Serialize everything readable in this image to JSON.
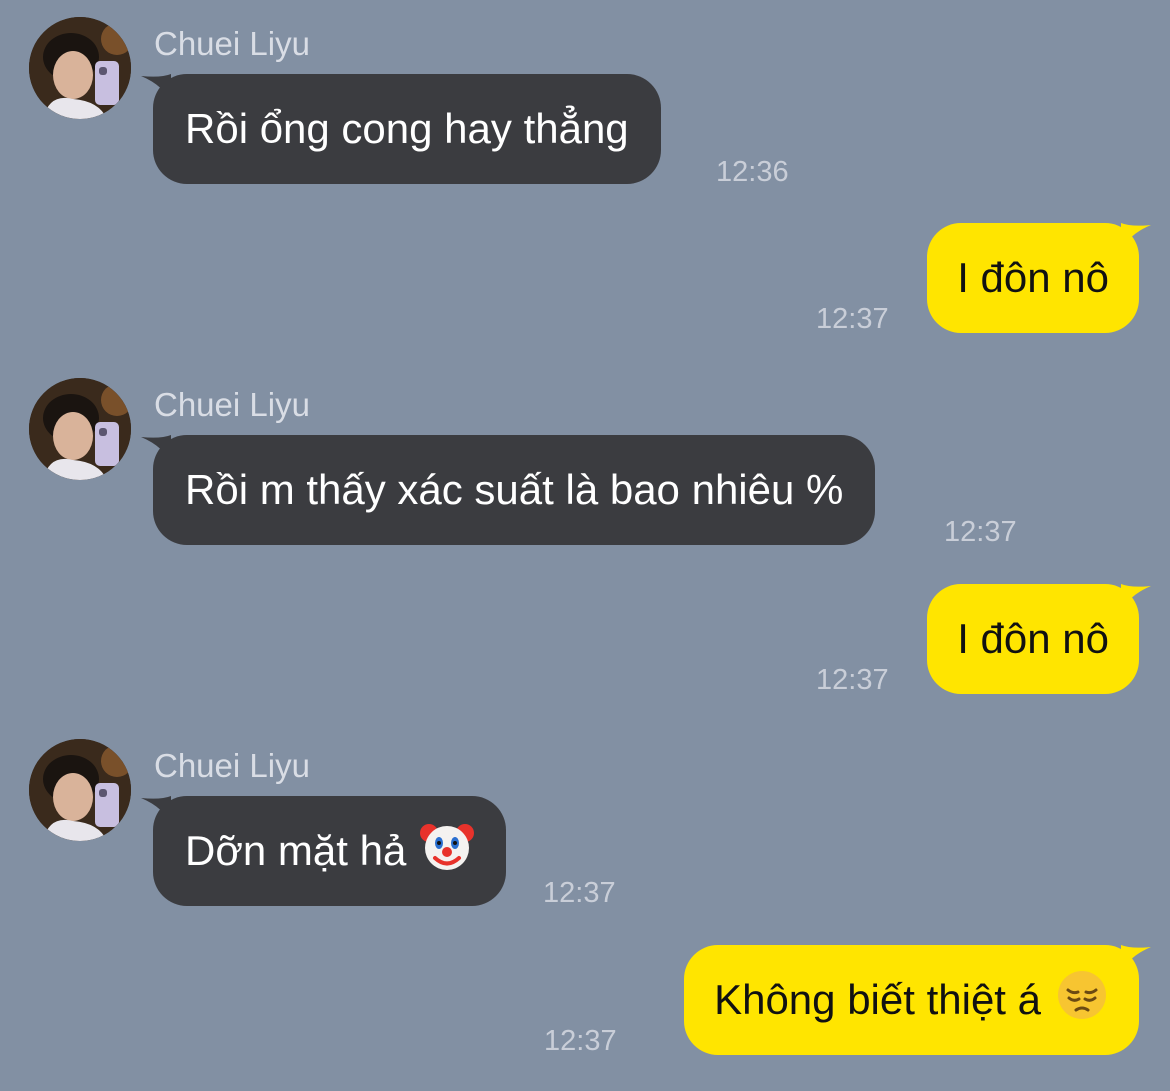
{
  "messages": [
    {
      "direction": "incoming",
      "sender": "Chuei Liyu",
      "text": "Rồi ổng cong hay thẳng",
      "time": "12:36"
    },
    {
      "direction": "outgoing",
      "text": "I đôn nô",
      "time": "12:37"
    },
    {
      "direction": "incoming",
      "sender": "Chuei Liyu",
      "text": "Rồi m thấy xác suất là bao nhiêu %",
      "time": "12:37"
    },
    {
      "direction": "outgoing",
      "text": "I đôn nô",
      "time": "12:37"
    },
    {
      "direction": "incoming",
      "sender": "Chuei Liyu",
      "text": "Dỡn mặt hả",
      "emoji": "clown-face",
      "time": "12:37"
    },
    {
      "direction": "outgoing",
      "text": "Không biết thiệt á",
      "emoji": "pensive-face",
      "time": "12:37"
    }
  ],
  "colors": {
    "background": "#8290a3",
    "incoming_bubble": "#3b3c40",
    "outgoing_bubble": "#ffe500"
  }
}
